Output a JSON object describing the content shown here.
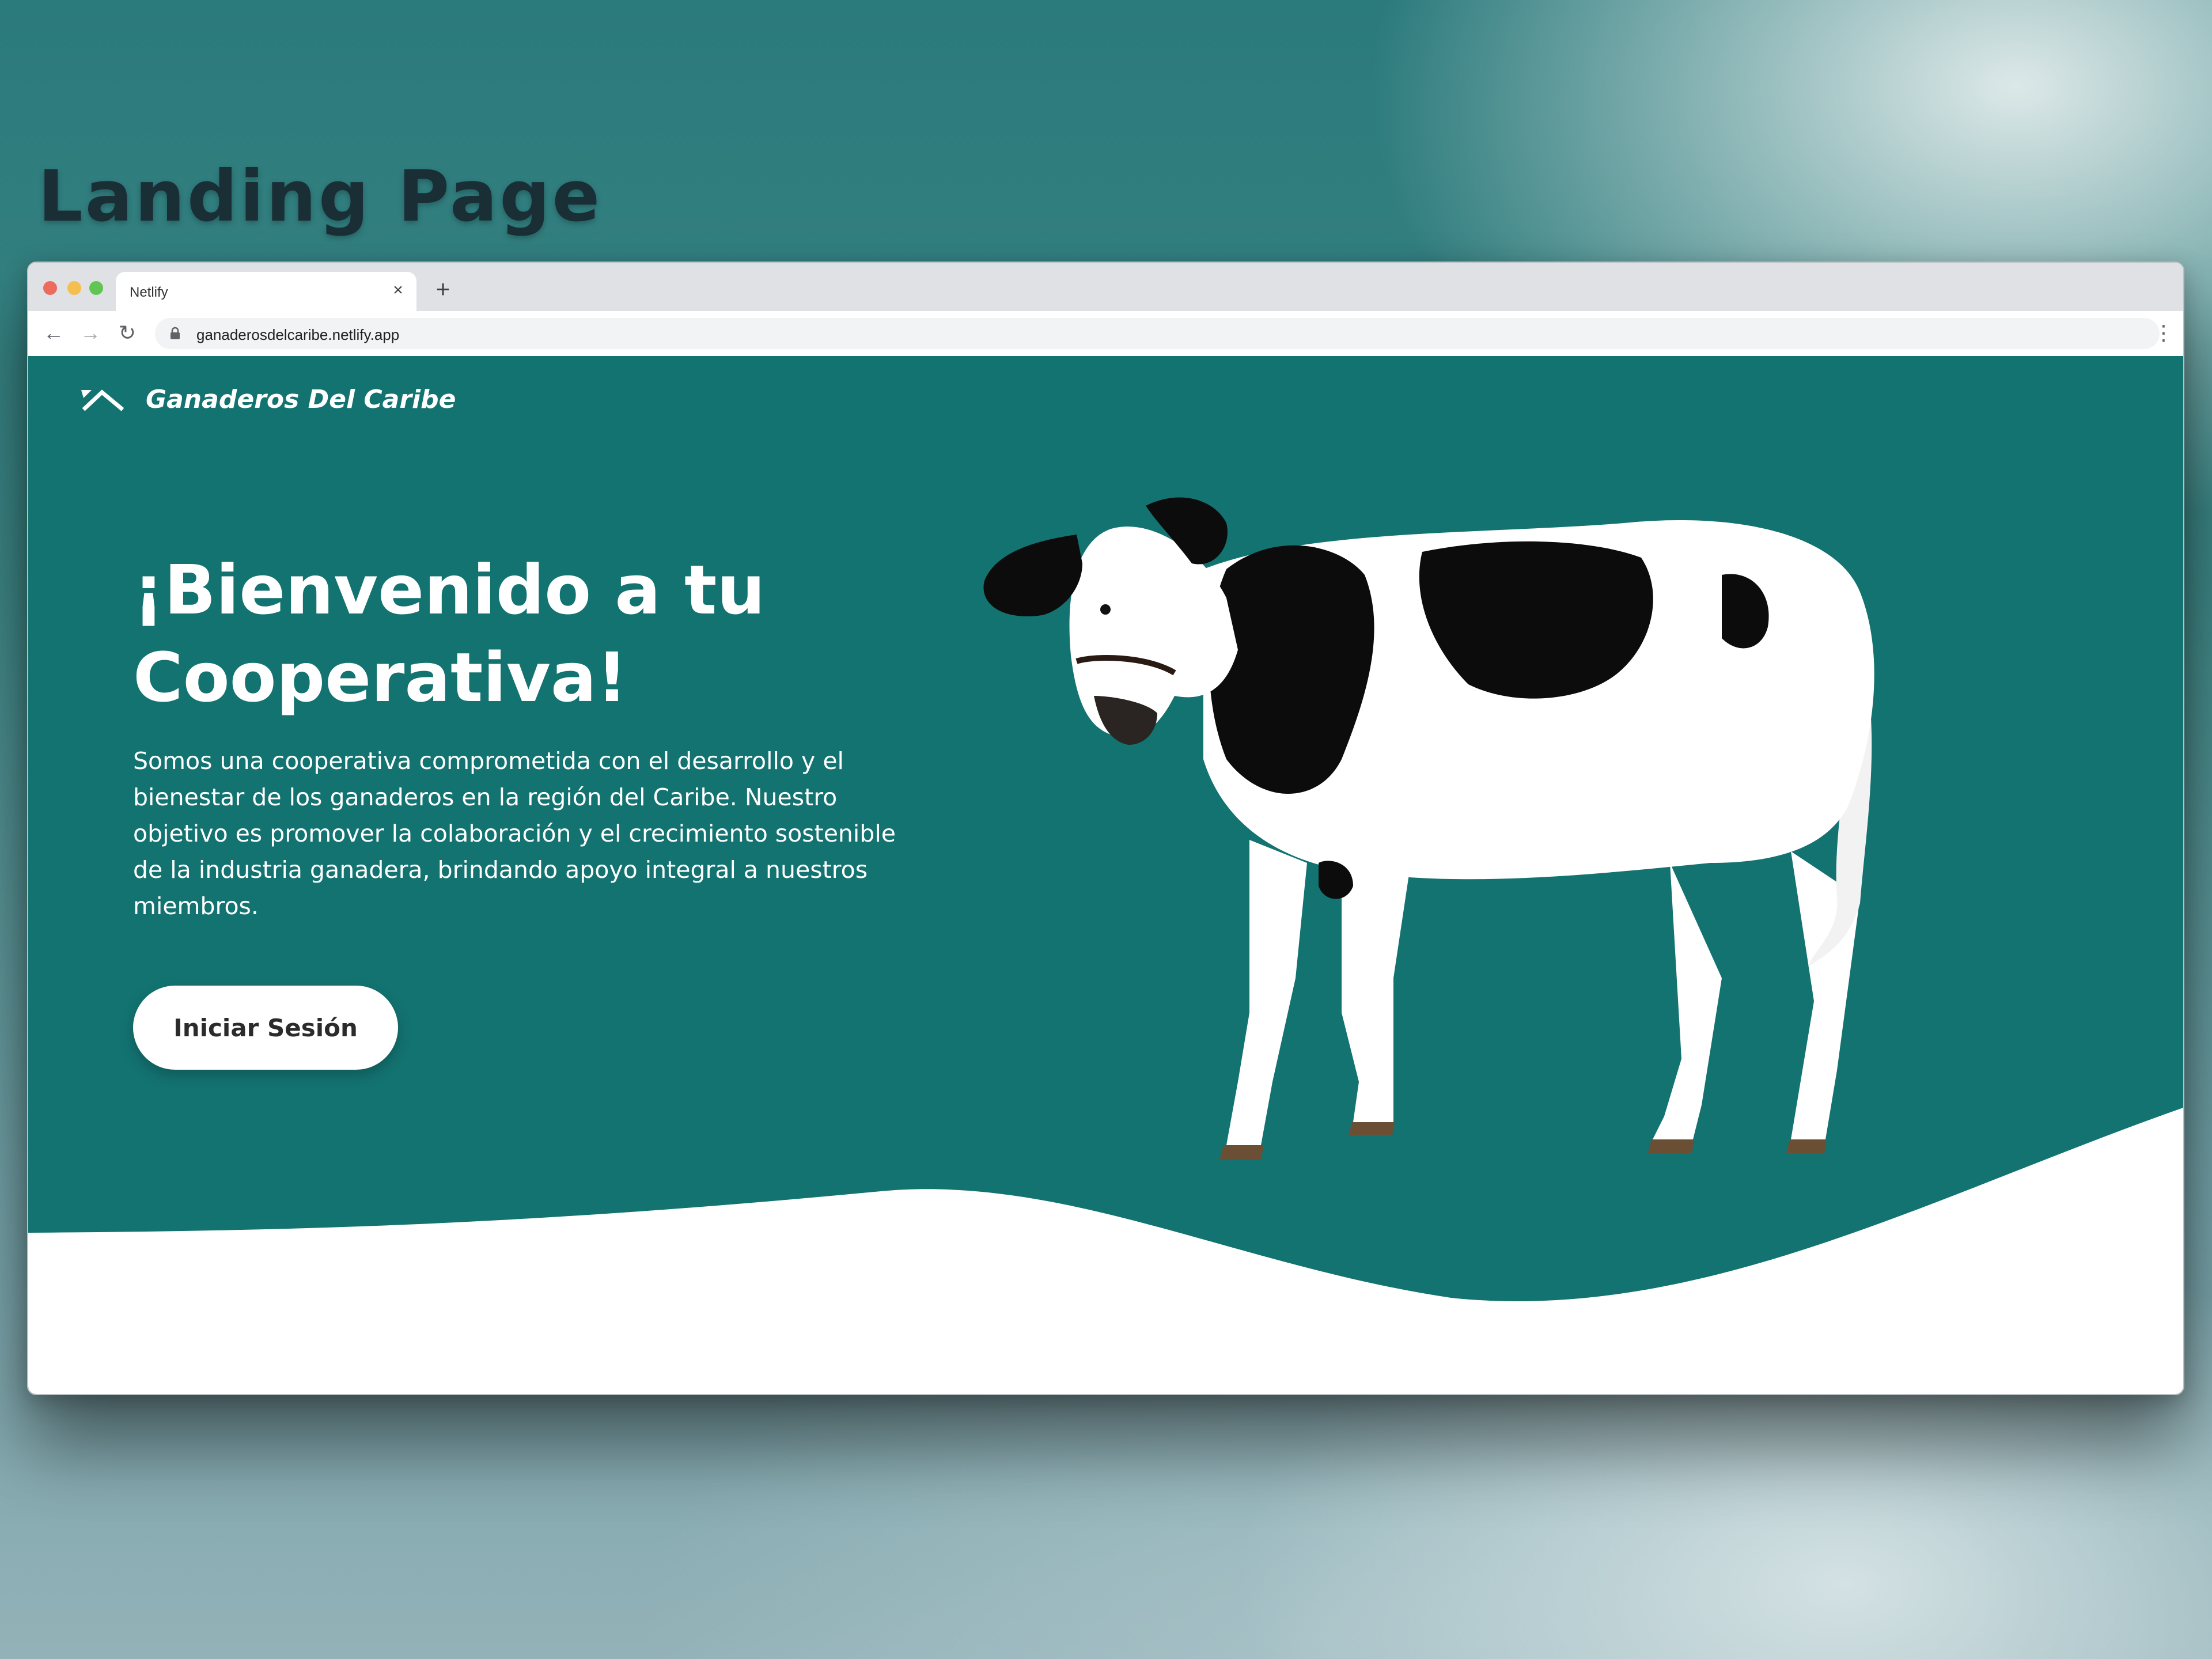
{
  "page_heading": "Landing Page",
  "browser": {
    "tab_title": "Netlify",
    "tab_close_icon": "close-icon",
    "new_tab_icon": "plus-icon",
    "url": "ganaderosdelcaribe.netlify.app",
    "nav_icons": [
      "back-arrow-icon",
      "forward-arrow-icon",
      "reload-icon",
      "lock-icon",
      "more-vert-icon"
    ]
  },
  "site": {
    "brand_name": "Ganaderos Del Caribe",
    "brand_icon": "chevron-logo-icon",
    "hero_title": "¡Bienvenido a tu Cooperativa!",
    "hero_description": "Somos una cooperativa comprometida con el desarrollo y el bienestar de los ganaderos en la región del Caribe. Nuestro objetivo es promover la colaboración y el crecimiento sostenible de la industria ganadera, brindando apoyo integral a nuestros miembros.",
    "cta_label": "Iniciar Sesión",
    "hero_image": "holstein-cow-image"
  },
  "colors": {
    "hero_bg": "#137371",
    "wave": "#ffffff",
    "button_bg": "#ffffff",
    "button_text": "#2b2b2b",
    "heading_text": "#1a2e36"
  }
}
